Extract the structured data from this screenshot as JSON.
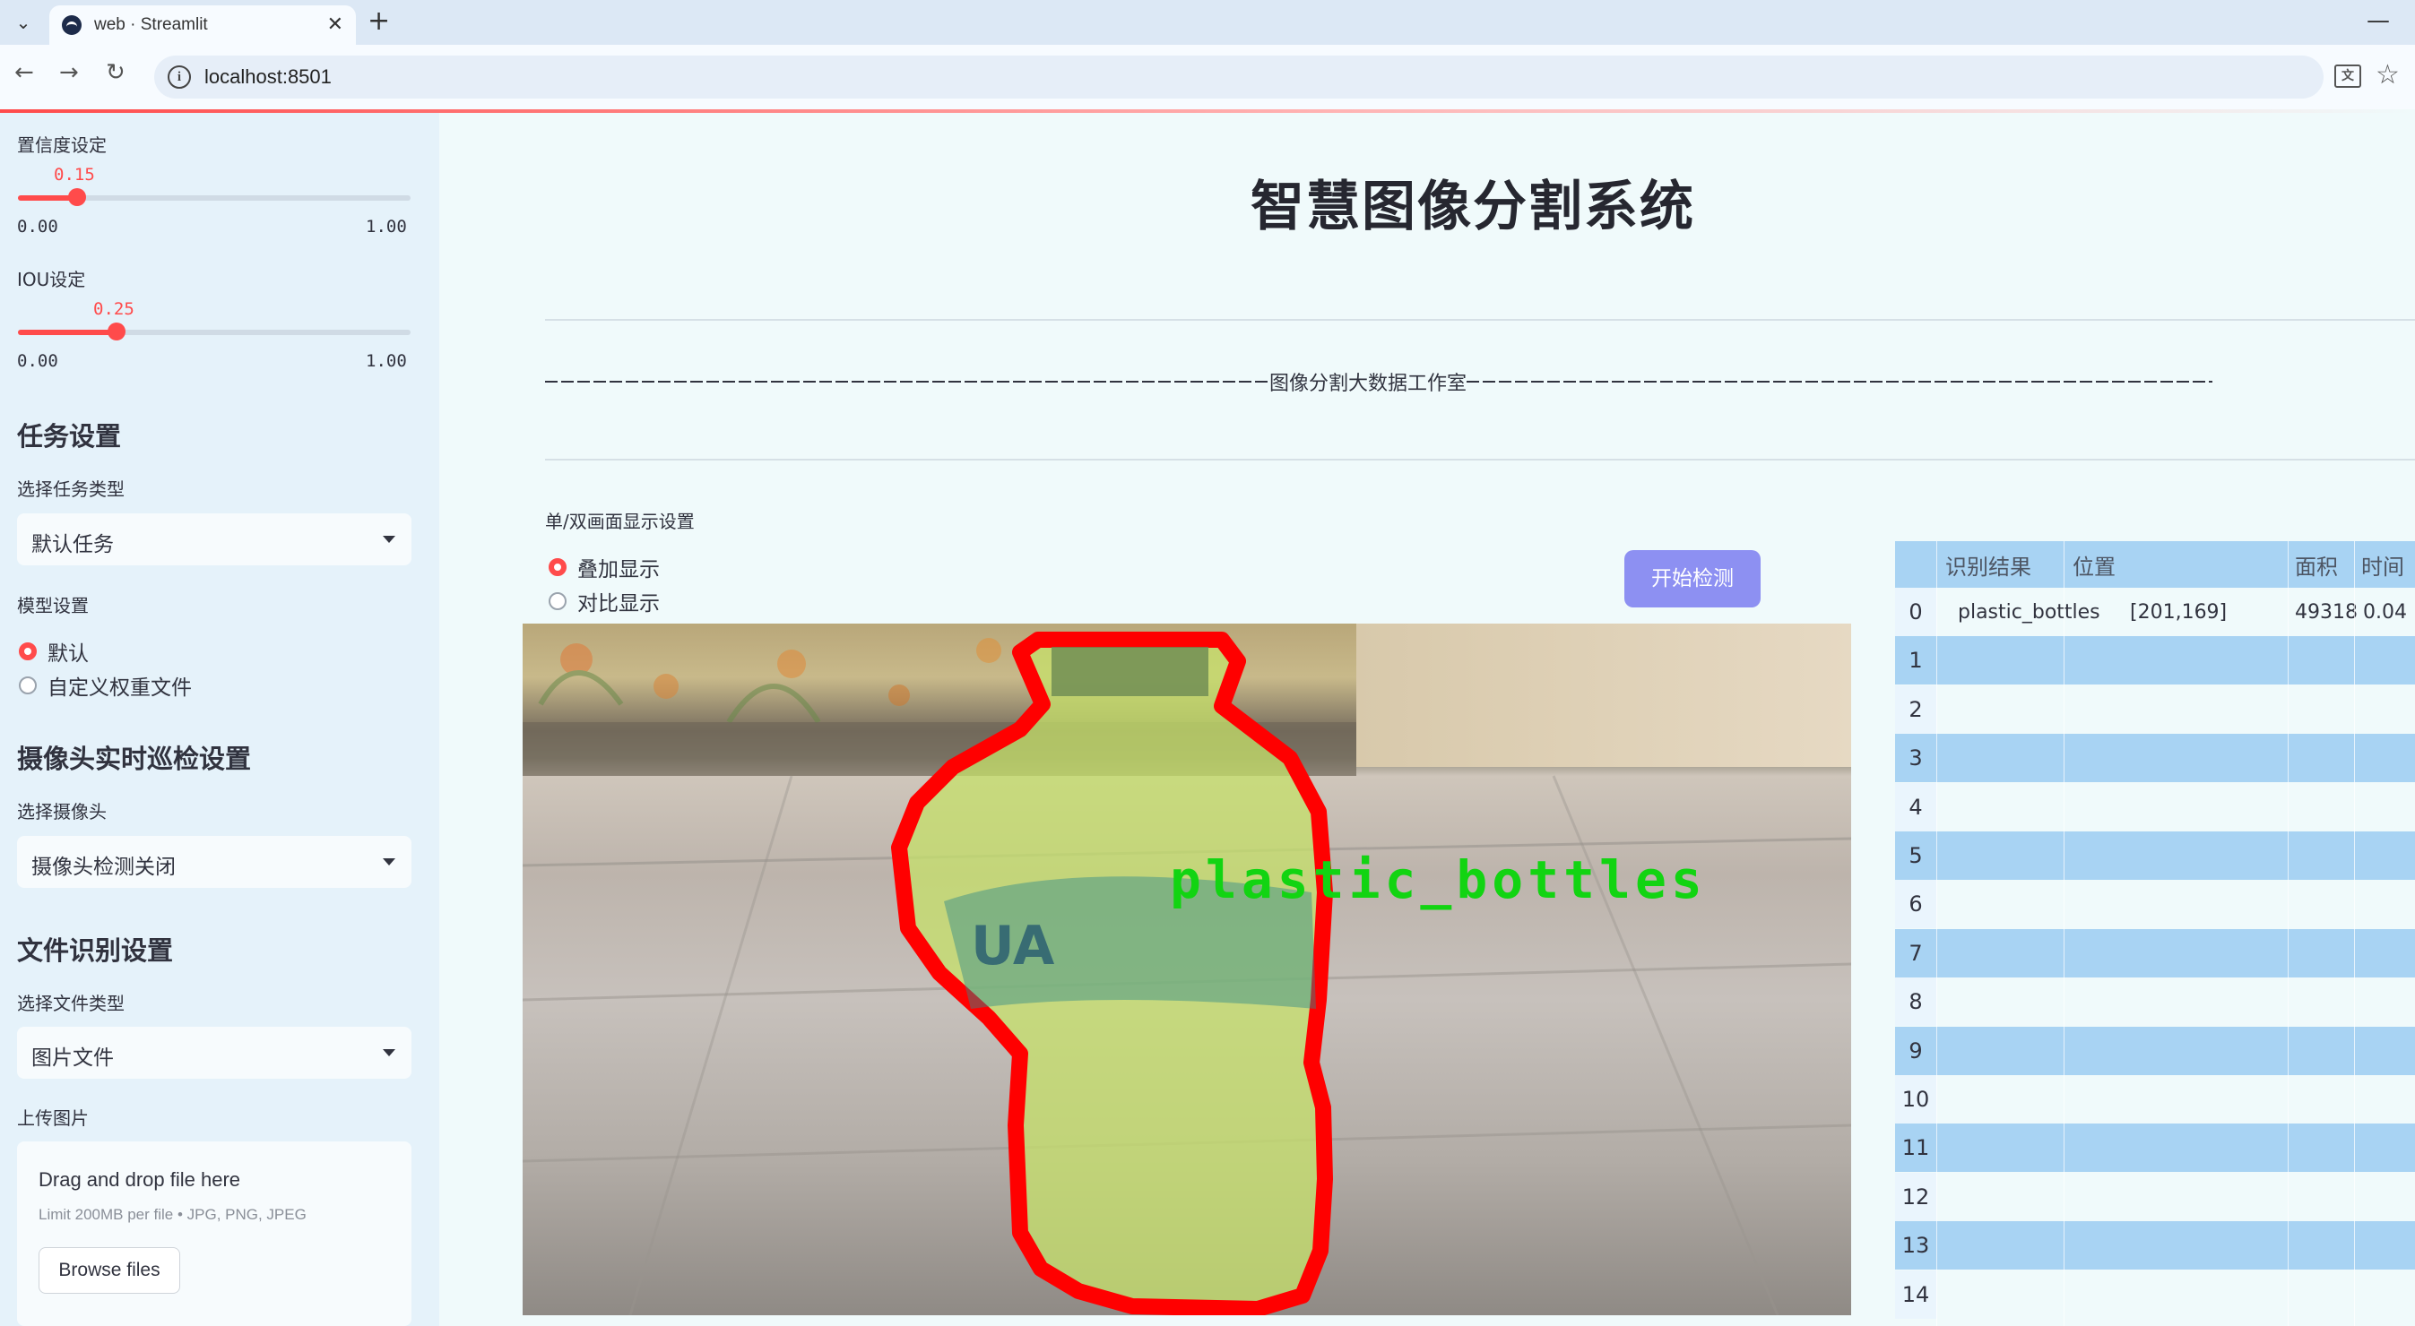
{
  "browser": {
    "tab_title": "web · Streamlit",
    "url": "localhost:8501"
  },
  "sidebar": {
    "confidence": {
      "label": "置信度设定",
      "value": "0.15",
      "min": "0.00",
      "max": "1.00",
      "fraction": 0.15
    },
    "iou": {
      "label": "IOU设定",
      "value": "0.25",
      "min": "0.00",
      "max": "1.00",
      "fraction": 0.25
    },
    "task_heading": "任务设置",
    "task_label": "选择任务类型",
    "task_value": "默认任务",
    "model_label": "模型设置",
    "model_options": [
      "默认",
      "自定义权重文件"
    ],
    "camera_heading": "摄像头实时巡检设置",
    "camera_label": "选择摄像头",
    "camera_value": "摄像头检测关闭",
    "file_heading": "文件识别设置",
    "file_type_label": "选择文件类型",
    "file_type_value": "图片文件",
    "upload_label": "上传图片",
    "upload_title": "Drag and drop file here",
    "upload_hint": "Limit 200MB per file • JPG, PNG, JPEG",
    "browse_label": "Browse files"
  },
  "main": {
    "title": "智慧图像分割系统",
    "caption": "图像分割大数据工作室",
    "display_label": "单/双画面显示设置",
    "display_options": [
      "叠加显示",
      "对比显示"
    ],
    "detect_button": "开始检测",
    "detection_label": "plastic_bottles"
  },
  "table": {
    "headers": [
      "识别结果",
      "位置",
      "面积",
      "时间"
    ],
    "rows": [
      {
        "idx": "0",
        "result": "plastic_bottles",
        "position": "[201,169]",
        "area": "49318",
        "time": "0.04"
      },
      {
        "idx": "1"
      },
      {
        "idx": "2"
      },
      {
        "idx": "3"
      },
      {
        "idx": "4"
      },
      {
        "idx": "5"
      },
      {
        "idx": "6"
      },
      {
        "idx": "7"
      },
      {
        "idx": "8"
      },
      {
        "idx": "9"
      },
      {
        "idx": "10"
      },
      {
        "idx": "11"
      },
      {
        "idx": "12"
      },
      {
        "idx": "13"
      },
      {
        "idx": "14"
      }
    ]
  },
  "colors": {
    "accent": "#ff4b4b",
    "button": "#8d90f2",
    "table_stripe": "#a8d3f3",
    "mask_outline": "#ff0000",
    "label_green": "#12d412"
  }
}
